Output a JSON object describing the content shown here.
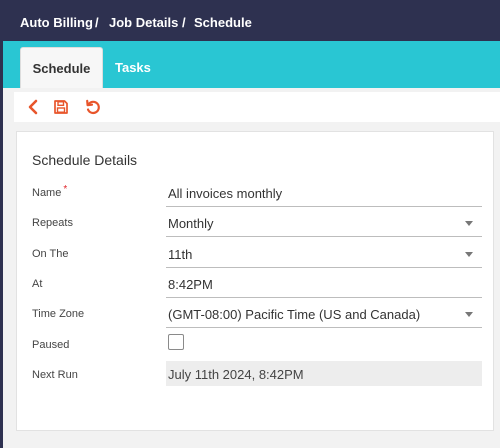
{
  "breadcrumb": {
    "items": [
      "Auto Billing",
      "Job Details",
      "Schedule"
    ],
    "separator": "/"
  },
  "tabs": {
    "active": "Schedule",
    "other": "Tasks"
  },
  "toolbar": {
    "back_icon": "chevron-left-icon",
    "save_icon": "floppy-disk-icon",
    "refresh_icon": "refresh-icon",
    "icon_color": "#e8552b"
  },
  "card": {
    "title": "Schedule Details",
    "fields": {
      "name": {
        "label": "Name",
        "required_mark": "*",
        "value": "All invoices monthly"
      },
      "repeats": {
        "label": "Repeats",
        "value": "Monthly"
      },
      "on_the": {
        "label": "On The",
        "value": "11th"
      },
      "at": {
        "label": "At",
        "value": "8:42PM"
      },
      "time_zone": {
        "label": "Time Zone",
        "value": "(GMT-08:00) Pacific Time (US and Canada)"
      },
      "paused": {
        "label": "Paused",
        "checked": false
      },
      "next_run": {
        "label": "Next Run",
        "value": "July 11th 2024, 8:42PM"
      }
    }
  },
  "colors": {
    "header_bg": "#2e3150",
    "tab_bar_bg": "#29c6d3",
    "accent_icon": "#e8552b",
    "required": "#e0262b"
  }
}
